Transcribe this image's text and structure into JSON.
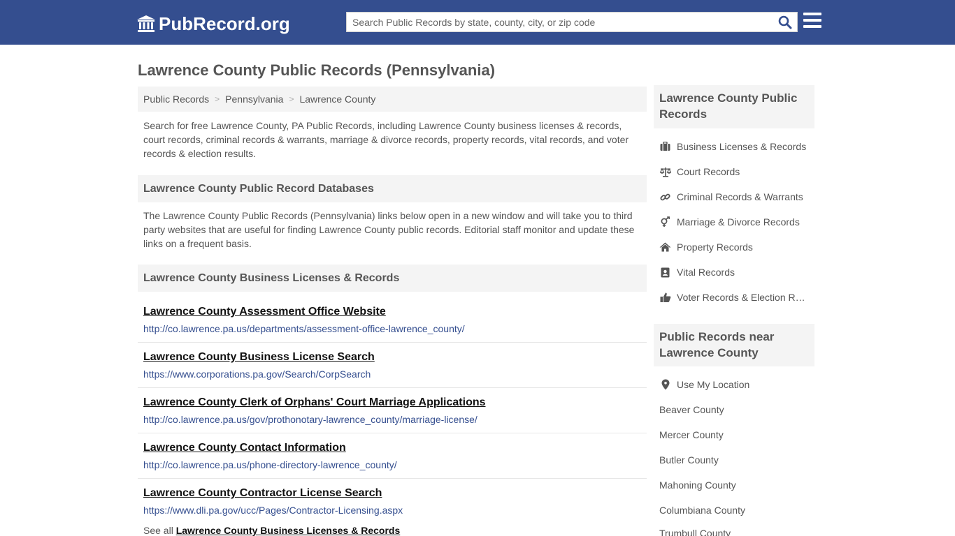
{
  "header": {
    "logo_text": "PubRecord.org",
    "search_placeholder": "Search Public Records by state, county, city, or zip code",
    "brand_color": "#344e8f"
  },
  "page": {
    "title": "Lawrence County Public Records (Pennsylvania)"
  },
  "breadcrumb": [
    "Public Records",
    "Pennsylvania",
    "Lawrence County"
  ],
  "intro": "Search for free Lawrence County, PA Public Records, including Lawrence County business licenses & records, court records, criminal records & warrants, marriage & divorce records, property records, vital records, and voter records & election results.",
  "databases": {
    "heading": "Lawrence County Public Record Databases",
    "description": "The Lawrence County Public Records (Pennsylvania) links below open in a new window and will take you to third party websites that are useful for finding Lawrence County public records. Editorial staff monitor and update these links on a frequent basis."
  },
  "business_section": {
    "heading": "Lawrence County Business Licenses & Records",
    "records": [
      {
        "title": "Lawrence County Assessment Office Website",
        "url": "http://co.lawrence.pa.us/departments/assessment-office-lawrence_county/"
      },
      {
        "title": "Lawrence County Business License Search",
        "url": "https://www.corporations.pa.gov/Search/CorpSearch"
      },
      {
        "title": "Lawrence County Clerk of Orphans' Court Marriage Applications",
        "url": "http://co.lawrence.pa.us/gov/prothonotary-lawrence_county/marriage-license/"
      },
      {
        "title": "Lawrence County Contact Information",
        "url": "http://co.lawrence.pa.us/phone-directory-lawrence_county/"
      },
      {
        "title": "Lawrence County Contractor License Search",
        "url": "https://www.dli.pa.gov/ucc/Pages/Contractor-Licensing.aspx"
      }
    ],
    "see_all_prefix": "See all",
    "see_all_link": "Lawrence County Business Licenses & Records"
  },
  "sidebar": {
    "records_heading": "Lawrence County Public Records",
    "records_items": [
      {
        "label": "Business Licenses & Records",
        "icon": "briefcase-icon"
      },
      {
        "label": "Court Records",
        "icon": "scales-icon"
      },
      {
        "label": "Criminal Records & Warrants",
        "icon": "link-icon"
      },
      {
        "label": "Marriage & Divorce Records",
        "icon": "gender-icon"
      },
      {
        "label": "Property Records",
        "icon": "home-icon"
      },
      {
        "label": "Vital Records",
        "icon": "id-card-icon"
      },
      {
        "label": "Voter Records & Election Results",
        "icon": "thumbs-up-icon"
      }
    ],
    "near_heading": "Public Records near Lawrence County",
    "use_location": "Use My Location",
    "near_items": [
      "Beaver County",
      "Mercer County",
      "Butler County",
      "Mahoning County",
      "Columbiana County",
      "Trumbull County"
    ]
  }
}
